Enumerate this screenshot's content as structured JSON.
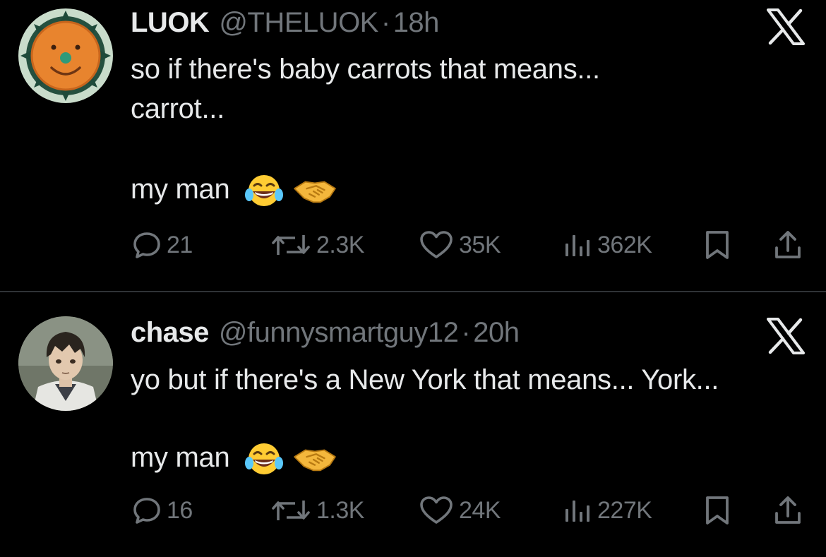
{
  "tweets": [
    {
      "display_name": "LUOK",
      "handle": "@THELUOK",
      "separator": "·",
      "time": "18h",
      "text_line1": "so if there's baby carrots that means...",
      "text_line2": "carrot...",
      "text_line3": "my man",
      "emojis": [
        "face-with-tears-of-joy",
        "handshake"
      ],
      "avatar": "orange-sun-face",
      "stats": {
        "replies": "21",
        "retweets": "2.3K",
        "likes": "35K",
        "views": "362K"
      }
    },
    {
      "display_name": "chase",
      "handle": "@funnysmartguy12",
      "separator": "·",
      "time": "20h",
      "text_line1": "yo but if there's a New York that means... York...",
      "text_line3": "my man",
      "emojis": [
        "face-with-tears-of-joy",
        "handshake"
      ],
      "avatar": "anime-character",
      "stats": {
        "replies": "16",
        "retweets": "1.3K",
        "likes": "24K",
        "views": "227K"
      }
    }
  ],
  "colors": {
    "background": "#000000",
    "primary_text": "#e7e9ea",
    "secondary_text": "#71767b",
    "divider": "#2f3336"
  },
  "icons": [
    "x-logo-icon",
    "reply-icon",
    "retweet-icon",
    "like-icon",
    "views-icon",
    "bookmark-icon",
    "share-icon"
  ]
}
